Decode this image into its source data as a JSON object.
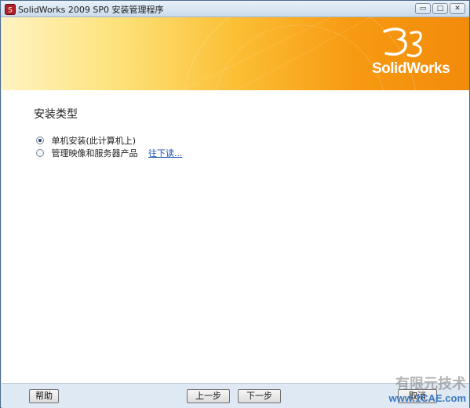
{
  "window": {
    "title": "SolidWorks 2009 SP0 安装管理程序",
    "controls": {
      "minimize": "▭",
      "maximize": "□",
      "close": "✕"
    }
  },
  "banner": {
    "logo_text": "SolidWorks"
  },
  "section": {
    "title": "安装类型"
  },
  "options": [
    {
      "label": "单机安装(此计算机上)",
      "checked": true
    },
    {
      "label": "管理映像和服务器产品",
      "checked": false,
      "link": "往下读..."
    }
  ],
  "footer": {
    "help": "帮助",
    "back": "上一步",
    "next": "下一步",
    "cancel": "取消"
  },
  "watermark": {
    "top": "有限元技术",
    "bottom": "www.1CAE.com"
  },
  "colors": {
    "banner_start": "#fff3c2",
    "banner_end": "#f28b0a",
    "link": "#1a56b4"
  },
  "icons": {
    "app": "solidworks-app-icon",
    "logo": "3ds-logo-icon"
  }
}
